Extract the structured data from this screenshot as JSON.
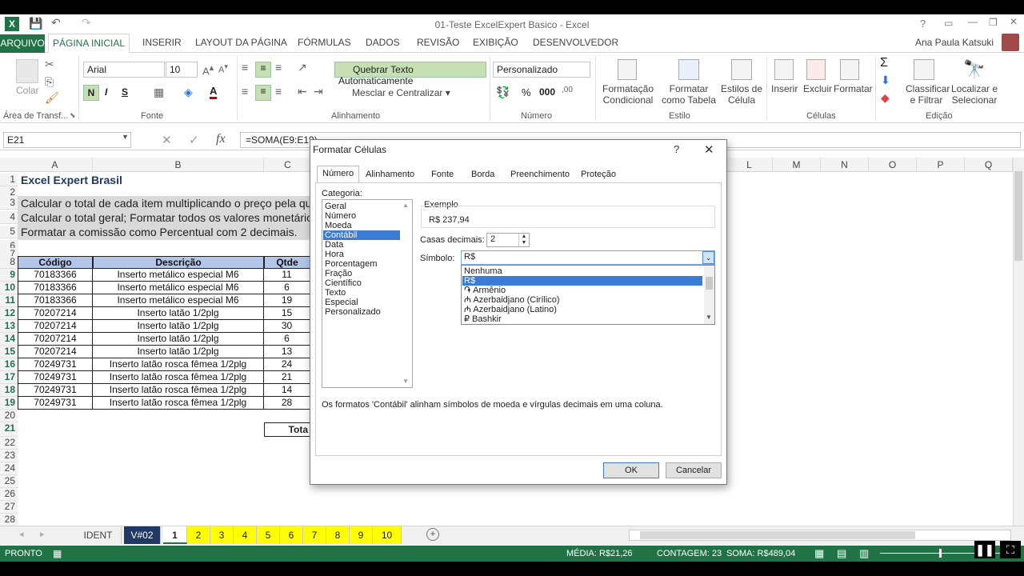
{
  "window": {
    "title": "01-Teste ExcelExpert Basico - Excel",
    "user": "Ana Paula Katsuki"
  },
  "ribbon_tabs": [
    "ARQUIVO",
    "PÁGINA INICIAL",
    "INSERIR",
    "LAYOUT DA PÁGINA",
    "FÓRMULAS",
    "DADOS",
    "REVISÃO",
    "EXIBIÇÃO",
    "DESENVOLVEDOR"
  ],
  "ribbon": {
    "paste_label": "Colar",
    "font_name": "Arial",
    "font_size": "10",
    "bold": "N",
    "italic": "I",
    "underline": "S",
    "wrap_text": "Quebrar Texto Automaticamente",
    "merge_center": "Mesclar e Centralizar",
    "number_format": "Personalizado",
    "conditional_format": "Formatação Condicional",
    "format_as_table": "Formatar como Tabela",
    "cell_styles": "Estilos de Célula",
    "insert": "Inserir",
    "delete": "Excluir",
    "format": "Formatar",
    "sort_filter": "Classificar e Filtrar",
    "find_select": "Localizar e Selecionar",
    "groups": {
      "clipboard": "Área de Transf...",
      "font": "Fonte",
      "alignment": "Alinhamento",
      "number": "Número",
      "styles": "Estilo",
      "cells": "Células",
      "editing": "Edição"
    }
  },
  "formula_bar": {
    "name_box": "E21",
    "formula": "=SOMA(E9:E19)"
  },
  "columns": [
    "A",
    "B",
    "C",
    "L",
    "M",
    "N",
    "O",
    "P",
    "Q"
  ],
  "sheet": {
    "title": "Excel Expert Brasil",
    "instructions": [
      "Calcular o total  de cada item multiplicando o preço pela qu",
      "Calcular o total geral; Formatar todos os valores monetários",
      "Formatar a comissão como Percentual com 2 decimais."
    ],
    "headers": [
      "Código",
      "Descrição",
      "Qtde"
    ],
    "rows": [
      [
        "70183366",
        "Inserto metálico especial M6",
        "11"
      ],
      [
        "70183366",
        "Inserto metálico especial M6",
        "6"
      ],
      [
        "70183366",
        "Inserto metálico especial M6",
        "19"
      ],
      [
        "70207214",
        "Inserto latão 1/2plg",
        "15"
      ],
      [
        "70207214",
        "Inserto latão 1/2plg",
        "30"
      ],
      [
        "70207214",
        "Inserto latão 1/2plg",
        "6"
      ],
      [
        "70207214",
        "Inserto latão 1/2plg",
        "13"
      ],
      [
        "70249731",
        "Inserto latão rosca fêmea 1/2plg",
        "24"
      ],
      [
        "70249731",
        "Inserto latão rosca fêmea 1/2plg",
        "21"
      ],
      [
        "70249731",
        "Inserto latão rosca fêmea 1/2plg",
        "14"
      ],
      [
        "70249731",
        "Inserto latão rosca fêmea 1/2plg",
        "28"
      ]
    ],
    "total_label": "Tota",
    "row_numbers": [
      "1",
      "2",
      "3",
      "4",
      "5",
      "6",
      "7",
      "8",
      "9",
      "10",
      "11",
      "12",
      "13",
      "14",
      "15",
      "16",
      "17",
      "18",
      "19",
      "20",
      "21",
      "22",
      "23",
      "24",
      "25",
      "26",
      "27",
      "28"
    ]
  },
  "sheet_tabs": [
    "IDENT",
    "V#02",
    "1",
    "2",
    "3",
    "4",
    "5",
    "6",
    "7",
    "8",
    "9",
    "10"
  ],
  "status": {
    "ready": "PRONTO",
    "average": "MÉDIA:  R$21,26",
    "count": "CONTAGEM: 23",
    "sum": "SOMA:  R$489,04"
  },
  "dialog": {
    "title": "Formatar Células",
    "help": "?",
    "tabs": [
      "Número",
      "Alinhamento",
      "Fonte",
      "Borda",
      "Preenchimento",
      "Proteção"
    ],
    "category_label": "Categoria:",
    "categories": [
      "Geral",
      "Número",
      "Moeda",
      "Contábil",
      "Data",
      "Hora",
      "Porcentagem",
      "Fração",
      "Científico",
      "Texto",
      "Especial",
      "Personalizado"
    ],
    "selected_category": "Contábil",
    "example_label": "Exemplo",
    "example_value": "R$ 237,94",
    "decimals_label": "Casas decimais:",
    "decimals_value": "2",
    "symbol_label": "Símbolo:",
    "symbol_value": "R$",
    "symbol_options": [
      "Nenhuma",
      "R$",
      "֏ Armênio",
      "₼ Azerbaidjano (Cirílico)",
      "₼ Azerbaidjano (Latino)",
      "₽ Bashkir"
    ],
    "description": "Os formatos 'Contábil' alinham símbolos de moeda e vírgulas decimais em uma coluna.",
    "ok": "OK",
    "cancel": "Cancelar"
  }
}
